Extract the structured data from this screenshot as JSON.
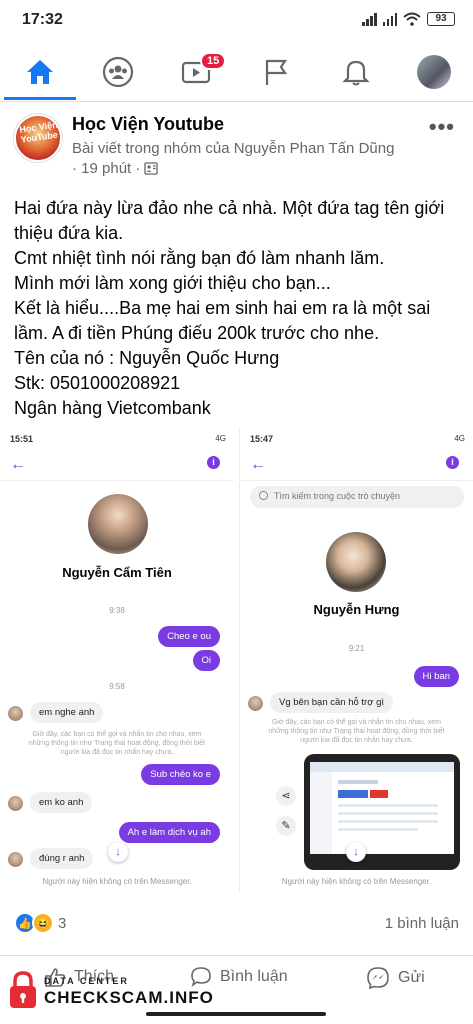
{
  "status_bar": {
    "time": "17:32",
    "battery": "93"
  },
  "nav": {
    "notifications_badge": "15"
  },
  "post": {
    "group_name": "Học Viện Youtube",
    "subtitle": "Bài viết trong nhóm của Nguyễn Phan Tấn Dũng",
    "time": "· 19 phút ·",
    "body": [
      "Hai đứa này lừa đảo nhe cả nhà. Một đứa tag tên giới thiệu đứa kia.",
      "Cmt nhiệt tình nói rằng bạn đó làm nhanh lăm.",
      "Mình mới làm xong giới thiệu cho bạn...",
      "Kết là hiểu....Ba mẹ hai em sinh hai em ra là một sai lầm. A đi tiền Phúng điếu 200k trước cho nhe.",
      "Tên của nó : Nguyễn Quốc Hưng",
      "Stk: 0501000208921",
      "Ngân hàng Vietcombank"
    ]
  },
  "screenshot_left": {
    "status_time": "15:51",
    "status_right": "4G",
    "contact_name": "Nguyễn Cẩm Tiên",
    "time1": "9:38",
    "msg_out1": "Cheo e ou",
    "msg_out2": "Oi",
    "time2": "9:58",
    "msg_in1": "em nghe anh",
    "system_note": "Giờ đây, các bạn có thể gọi và nhắn tin cho nhau, xem những thông tin như Trạng thái hoạt động, đồng thời biết người kia đã đọc tin nhắn hay chưa.",
    "msg_out3": "Sub chéo ko e",
    "msg_in2": "em ko anh",
    "msg_out4": "Ah e làm dịch vụ ah",
    "msg_in3": "đúng r anh",
    "footer": "Người này hiện không có trên Messenger."
  },
  "screenshot_right": {
    "status_time": "15:47",
    "status_right": "4G",
    "search_placeholder": "Tìm kiếm trong cuộc trò chuyện",
    "contact_name": "Nguyễn Hưng",
    "time1": "9:21",
    "msg_out1": "Hi ban",
    "msg_in1": "Vg bên bạn cần hỗ trợ gì",
    "system_note": "Giờ đây, các bạn có thể gọi và nhắn tin cho nhau, xem những thông tin như Trạng thái hoạt động, đồng thời biết người kia đã đọc tin nhắn hay chưa.",
    "footer": "Người này hiện không có trên Messenger."
  },
  "reactions": {
    "count": "3",
    "comments": "1 bình luận"
  },
  "actions": {
    "like": "Thích",
    "comment": "Bình luận",
    "share": "Gửi"
  },
  "watermark": {
    "top": "DATA CENTER",
    "main": "CHECKSCAM.INFO"
  },
  "colors": {
    "facebook_blue": "#1877f2",
    "messenger_purple": "#7a3ce2"
  }
}
